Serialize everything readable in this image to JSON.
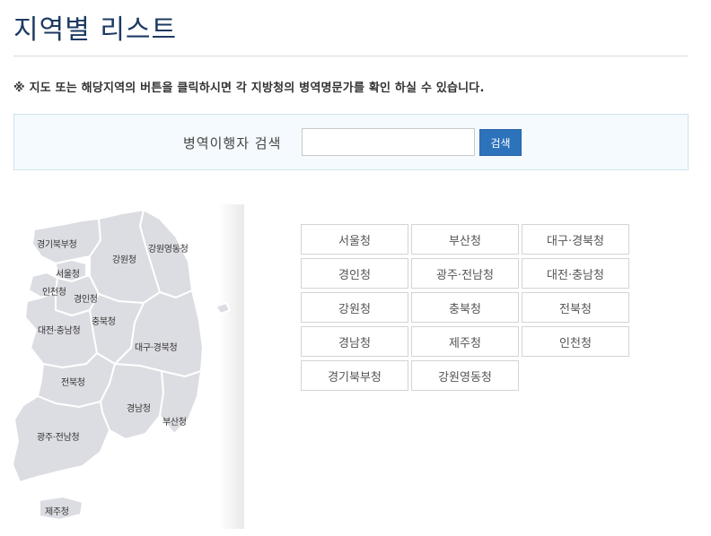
{
  "page": {
    "title": "지역별 리스트",
    "notice": "※ 지도 또는 해당지역의 버튼을 클릭하시면 각 지방청의 병역명문가를 확인 하실 수 있습니다."
  },
  "search": {
    "label": "병역이행자 검색",
    "value": "",
    "button_label": "검색"
  },
  "map": {
    "regions": [
      {
        "id": "gyeonggibuk",
        "label": "경기북부청"
      },
      {
        "id": "gangwonyeongdong",
        "label": "강원영동청"
      },
      {
        "id": "gangwon",
        "label": "강원청"
      },
      {
        "id": "seoul",
        "label": "서울청"
      },
      {
        "id": "incheon",
        "label": "인천청"
      },
      {
        "id": "gyeongin",
        "label": "경인청"
      },
      {
        "id": "chungbuk",
        "label": "충북청"
      },
      {
        "id": "daejeon",
        "label": "대전·충남청"
      },
      {
        "id": "daegu",
        "label": "대구·경북청"
      },
      {
        "id": "jeonbuk",
        "label": "전북청"
      },
      {
        "id": "gyeongnam",
        "label": "경남청"
      },
      {
        "id": "busan",
        "label": "부산청"
      },
      {
        "id": "gwangju",
        "label": "광주·전남청"
      },
      {
        "id": "jeju",
        "label": "제주청"
      }
    ]
  },
  "offices": [
    "서울청",
    "부산청",
    "대구·경북청",
    "경인청",
    "광주·전남청",
    "대전·충남청",
    "강원청",
    "충북청",
    "전북청",
    "경남청",
    "제주청",
    "인천청",
    "경기북부청",
    "강원영동청"
  ],
  "colors": {
    "title": "#1d3a63",
    "button": "#2d73bb",
    "map_fill": "#dcdde2",
    "map_border": "#ffffff"
  }
}
